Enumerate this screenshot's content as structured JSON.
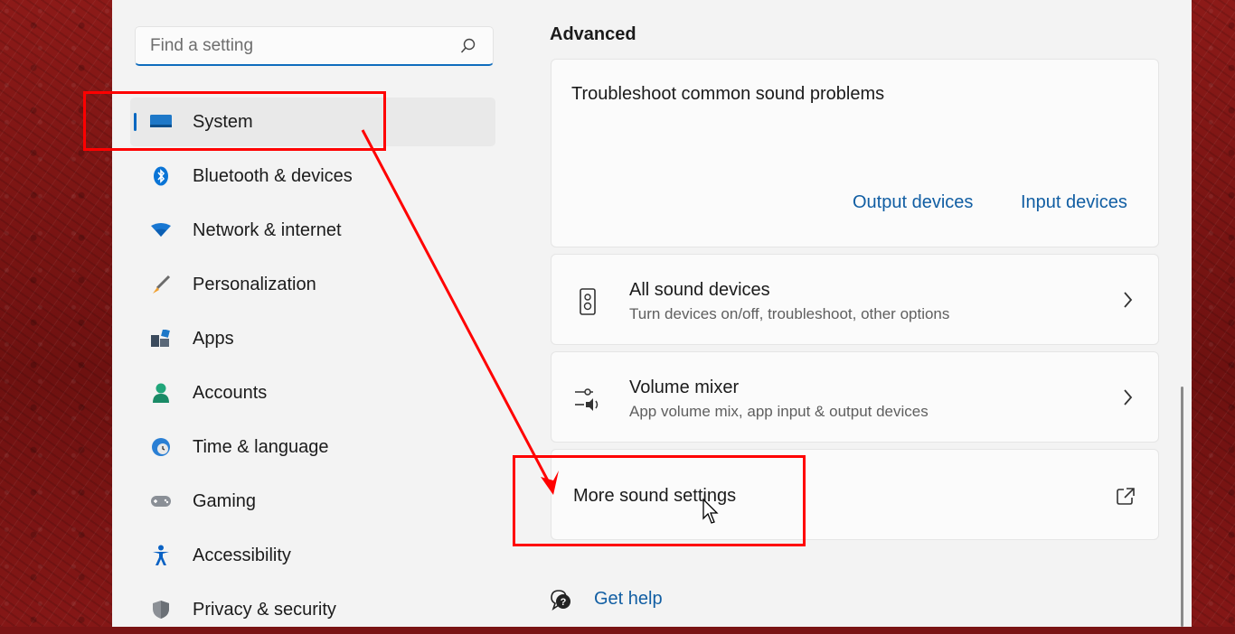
{
  "search": {
    "placeholder": "Find a setting",
    "icon": "search-icon"
  },
  "nav": {
    "items": [
      {
        "label": "System",
        "icon": "system-monitor-icon",
        "selected": true
      },
      {
        "label": "Bluetooth & devices",
        "icon": "bluetooth-icon"
      },
      {
        "label": "Network & internet",
        "icon": "wifi-icon"
      },
      {
        "label": "Personalization",
        "icon": "brush-icon"
      },
      {
        "label": "Apps",
        "icon": "apps-icon"
      },
      {
        "label": "Accounts",
        "icon": "person-icon"
      },
      {
        "label": "Time & language",
        "icon": "globe-clock-icon"
      },
      {
        "label": "Gaming",
        "icon": "gamepad-icon"
      },
      {
        "label": "Accessibility",
        "icon": "accessibility-icon"
      },
      {
        "label": "Privacy & security",
        "icon": "shield-icon"
      }
    ]
  },
  "main": {
    "section_title": "Advanced",
    "troubleshoot": {
      "title": "Troubleshoot common sound problems",
      "links": [
        "Output devices",
        "Input devices"
      ]
    },
    "rows": [
      {
        "title": "All sound devices",
        "subtitle": "Turn devices on/off, troubleshoot, other options",
        "icon": "speaker-icon"
      },
      {
        "title": "Volume mixer",
        "subtitle": "App volume mix, app input & output devices",
        "icon": "volume-mixer-icon"
      },
      {
        "title": "More sound settings",
        "icon": "open-external-icon"
      }
    ],
    "help": {
      "label": "Get help",
      "icon": "help-icon"
    }
  },
  "colors": {
    "accent": "#0067c0",
    "link": "#115ea3",
    "annotation": "#ff0000",
    "background": "#7a1414"
  }
}
